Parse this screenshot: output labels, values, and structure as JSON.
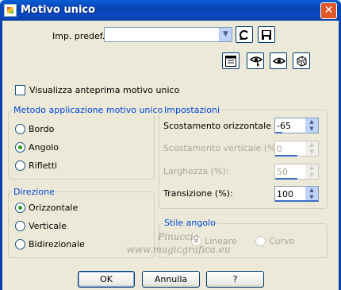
{
  "window": {
    "title": "Motivo unico",
    "close_glyph": "✕",
    "app_icon": "app-icon"
  },
  "preset": {
    "label": "Imp. predef.:",
    "value": ""
  },
  "preview_checkbox": {
    "label": "Visualizza anteprima motivo unico",
    "checked": false
  },
  "method_group": {
    "title": "Metodo applicazione motivo unico",
    "options": [
      {
        "label": "Bordo",
        "selected": false
      },
      {
        "label": "Angolo",
        "selected": true
      },
      {
        "label": "Rifletti",
        "selected": false
      }
    ]
  },
  "direction_group": {
    "title": "Direzione",
    "options": [
      {
        "label": "Orizzontale",
        "selected": true
      },
      {
        "label": "Verticale",
        "selected": false
      },
      {
        "label": "Bidirezionale",
        "selected": false
      }
    ]
  },
  "settings_group": {
    "title": "Impostazioni",
    "fields": [
      {
        "label": "Scostamento orizzontale (%):",
        "value": "-65",
        "enabled": true
      },
      {
        "label": "Scostamento verticale (%):",
        "value": "0",
        "enabled": false
      },
      {
        "label": "Larghezza (%):",
        "value": "50",
        "enabled": false
      },
      {
        "label": "Transizione (%):",
        "value": "100",
        "enabled": true
      }
    ]
  },
  "corner_style_group": {
    "title": "Stile angolo",
    "options": [
      {
        "label": "Lineare",
        "selected": true,
        "enabled": false
      },
      {
        "label": "Curvo",
        "selected": false,
        "enabled": false
      }
    ]
  },
  "buttons": {
    "ok": "OK",
    "cancel": "Annulla",
    "help": "?"
  },
  "watermark": {
    "line1": "Pinuccia",
    "line2": "www.magicgrafica.eu"
  },
  "colors": {
    "titlebar": "#0842b0",
    "dialog_bg": "#ece9d8",
    "group_title": "#0046d5"
  }
}
